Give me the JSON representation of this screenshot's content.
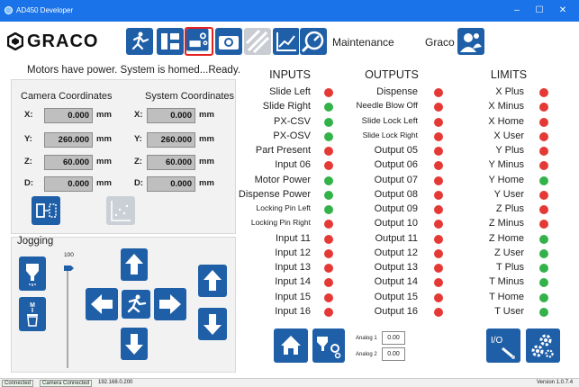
{
  "window": {
    "title": "AD450 Developer",
    "minimize": "–",
    "maximize": "☐",
    "close": "✕"
  },
  "brand": {
    "name": "GRACO"
  },
  "toolbar": {
    "section_label": "Maintenance",
    "user_label": "Graco"
  },
  "status_message": "Motors have power. System is homed...Ready.",
  "coordinates": {
    "camera_title": "Camera Coordinates",
    "system_title": "System Coordinates",
    "unit": "mm",
    "rows": [
      {
        "axis": "X:",
        "camera": "0.000",
        "system": "0.000"
      },
      {
        "axis": "Y:",
        "camera": "260.000",
        "system": "260.000"
      },
      {
        "axis": "Z:",
        "camera": "60.000",
        "system": "60.000"
      },
      {
        "axis": "D:",
        "camera": "0.000",
        "system": "0.000"
      }
    ]
  },
  "jogging": {
    "title": "Jogging",
    "speed_value": "100",
    "speed_level_percent": 100
  },
  "inputs": {
    "title": "INPUTS",
    "items": [
      {
        "label": "Slide Left",
        "state": "red"
      },
      {
        "label": "Slide Right",
        "state": "green"
      },
      {
        "label": "PX-CSV",
        "state": "green"
      },
      {
        "label": "PX-OSV",
        "state": "green"
      },
      {
        "label": "Part Present",
        "state": "red"
      },
      {
        "label": "Input 06",
        "state": "red"
      },
      {
        "label": "Motor Power",
        "state": "green"
      },
      {
        "label": "Dispense Power",
        "state": "green"
      },
      {
        "label": "Locking Pin Left",
        "state": "green"
      },
      {
        "label": "Locking Pin Right",
        "state": "red"
      },
      {
        "label": "Input 11",
        "state": "red"
      },
      {
        "label": "Input 12",
        "state": "red"
      },
      {
        "label": "Input 13",
        "state": "red"
      },
      {
        "label": "Input 14",
        "state": "red"
      },
      {
        "label": "Input 15",
        "state": "red"
      },
      {
        "label": "Input 16",
        "state": "red"
      }
    ]
  },
  "outputs": {
    "title": "OUTPUTS",
    "items": [
      {
        "label": "Dispense",
        "state": "red"
      },
      {
        "label": "Needle Blow Off",
        "state": "red"
      },
      {
        "label": "Slide Lock Left",
        "state": "red"
      },
      {
        "label": "Slide Lock Right",
        "state": "red"
      },
      {
        "label": "Output 05",
        "state": "red"
      },
      {
        "label": "Output 06",
        "state": "red"
      },
      {
        "label": "Output 07",
        "state": "red"
      },
      {
        "label": "Output 08",
        "state": "red"
      },
      {
        "label": "Output 09",
        "state": "red"
      },
      {
        "label": "Output 10",
        "state": "red"
      },
      {
        "label": "Output 11",
        "state": "red"
      },
      {
        "label": "Output 12",
        "state": "red"
      },
      {
        "label": "Output 13",
        "state": "red"
      },
      {
        "label": "Output 14",
        "state": "red"
      },
      {
        "label": "Output 15",
        "state": "red"
      },
      {
        "label": "Output 16",
        "state": "red"
      }
    ]
  },
  "limits": {
    "title": "LIMITS",
    "items": [
      {
        "label": "X Plus",
        "state": "red"
      },
      {
        "label": "X Minus",
        "state": "red"
      },
      {
        "label": "X Home",
        "state": "red"
      },
      {
        "label": "X User",
        "state": "red"
      },
      {
        "label": "Y Plus",
        "state": "red"
      },
      {
        "label": "Y Minus",
        "state": "red"
      },
      {
        "label": "Y Home",
        "state": "green"
      },
      {
        "label": "Y User",
        "state": "red"
      },
      {
        "label": "Z Plus",
        "state": "red"
      },
      {
        "label": "Z Minus",
        "state": "red"
      },
      {
        "label": "Z Home",
        "state": "green"
      },
      {
        "label": "Z User",
        "state": "green"
      },
      {
        "label": "T Plus",
        "state": "green"
      },
      {
        "label": "T Minus",
        "state": "green"
      },
      {
        "label": "T Home",
        "state": "green"
      },
      {
        "label": "T User",
        "state": "green"
      }
    ]
  },
  "analog": {
    "label1": "Analog 1",
    "value1": "0.00",
    "label2": "Analog 2",
    "value2": "0.00"
  },
  "io_button_label": "I/O",
  "statusbar": {
    "connected": "Connected",
    "camera": "Camera Connected",
    "ip": "192.168.0.200",
    "version": "Version 1.0.7.4"
  },
  "colors": {
    "accent": "#1f5fa8",
    "titlebar": "#1a73e8",
    "indicator_on": "#34b24a",
    "indicator_off": "#e53935",
    "selected_border": "#e62020"
  },
  "icons": {
    "toolbar": [
      "pump-jog-icon",
      "inputs-outputs-icon",
      "maintenance-icon",
      "camera-icon",
      "calibration-icon",
      "chart-icon",
      "gauge-icon",
      "user-icon"
    ]
  }
}
